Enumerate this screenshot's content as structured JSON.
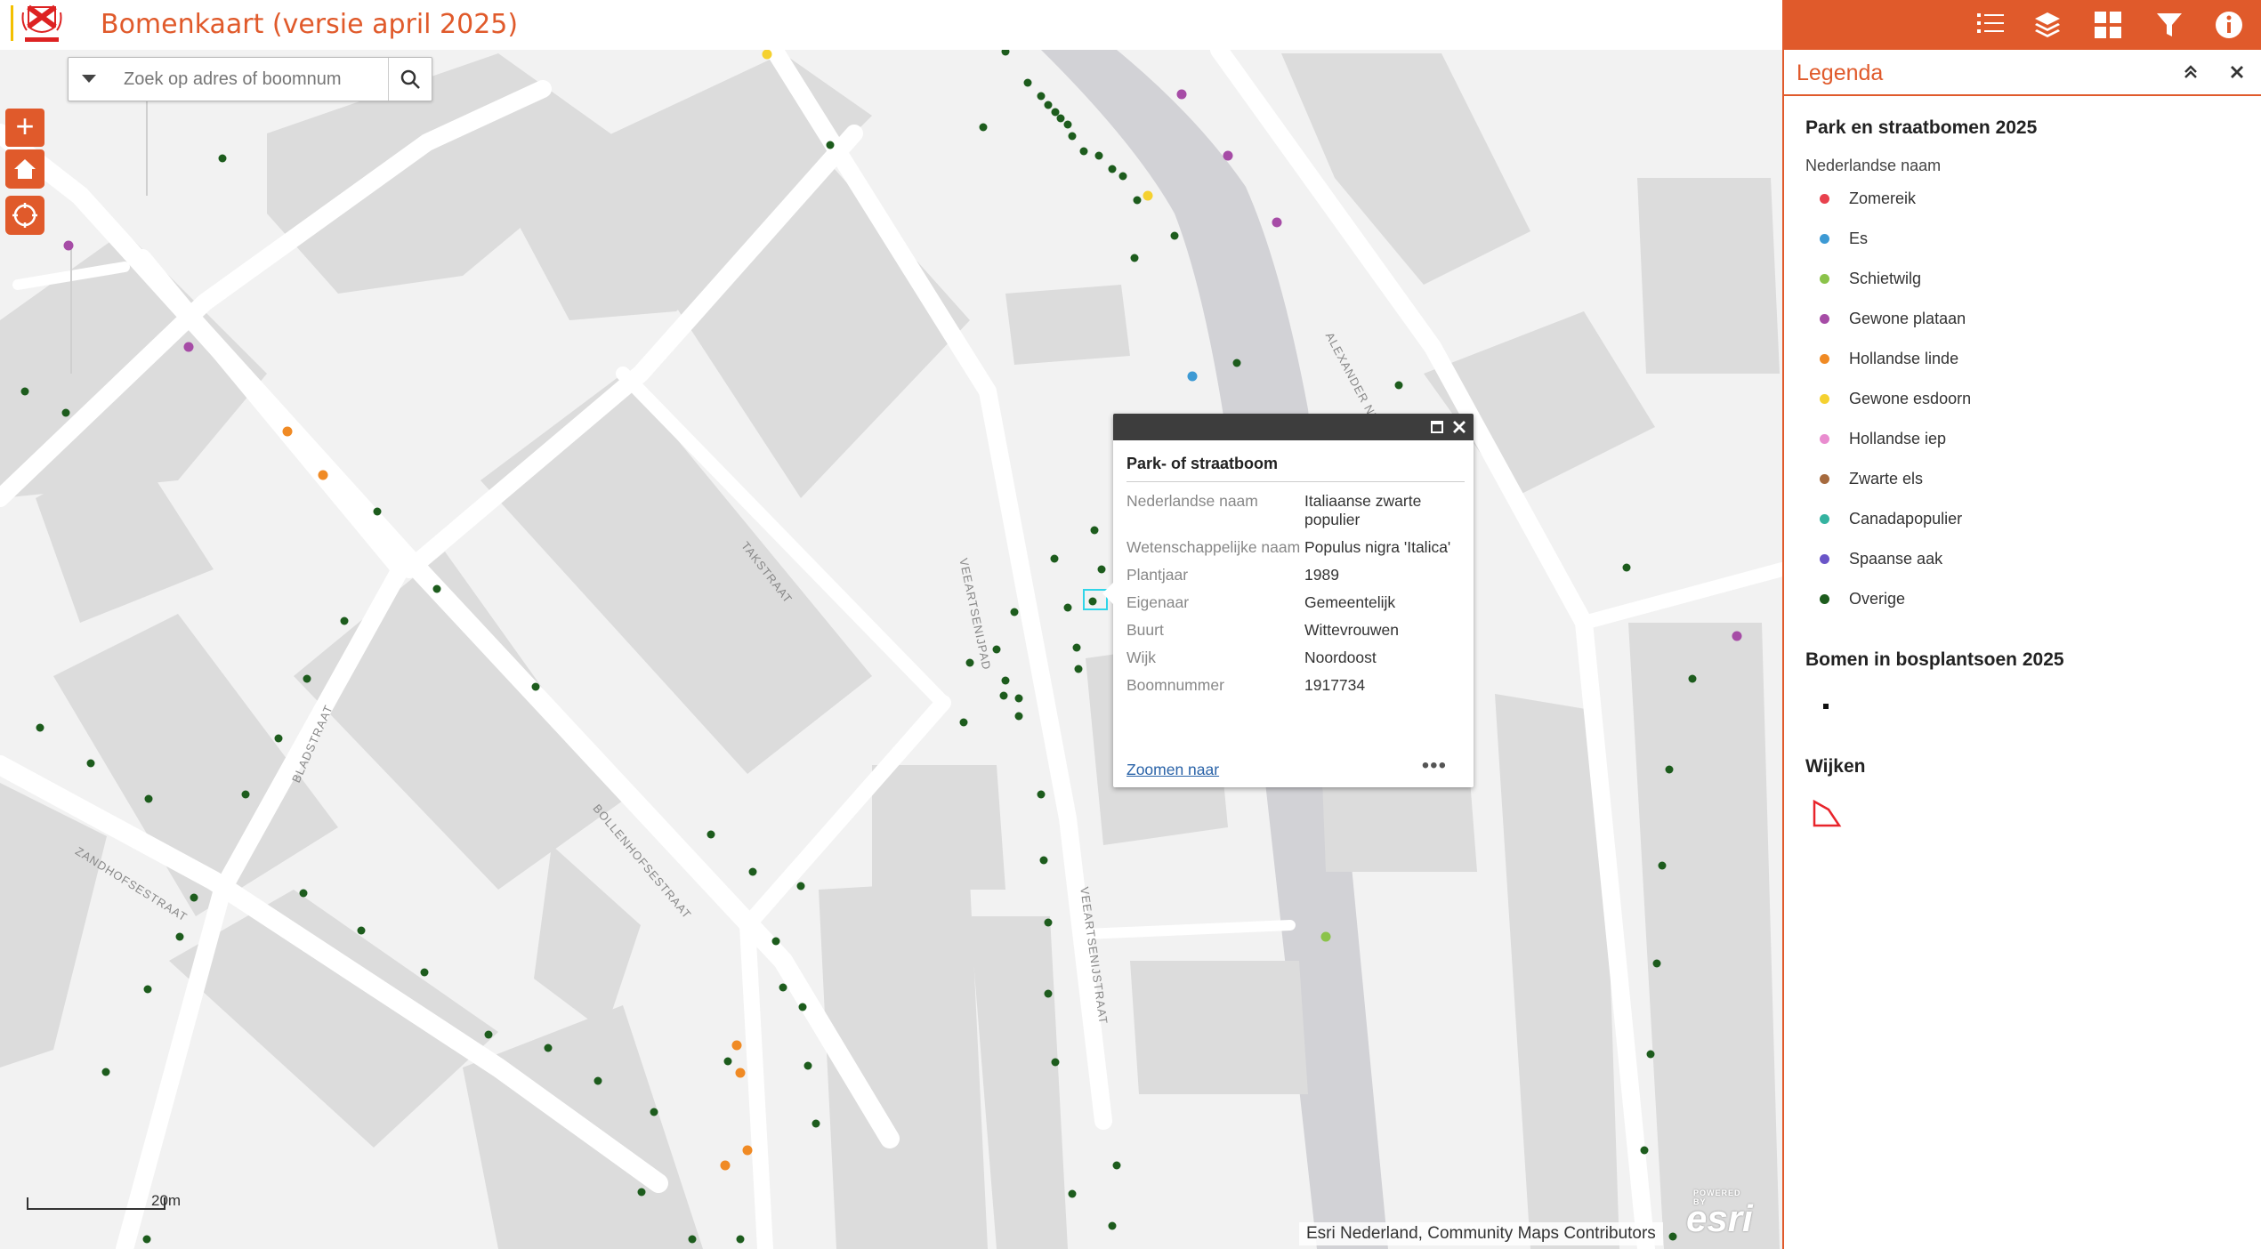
{
  "app": {
    "title": "Bomenkaart (versie april 2025)"
  },
  "toolbar": {
    "icons": [
      "list-icon",
      "layers-icon",
      "grid-icon",
      "filter-icon",
      "info-icon"
    ],
    "accent": "#e05a2b"
  },
  "search": {
    "placeholder": "Zoek op adres of boomnum"
  },
  "map": {
    "streets": [
      "TAKSTRAAT",
      "VEEARTSENIJPAD",
      "VEEARTSENIJSTRAAT",
      "BLADSTRAAT",
      "BOLLENHOFSESTRAAT",
      "ZANDHOFSESTRAAT",
      "ALEXANDER NUMANKADE"
    ],
    "scale_label": "20m",
    "attribution": "Esri Nederland, Community Maps Contributors",
    "esri_logo": "esri",
    "esri_powered": "POWERED BY"
  },
  "popup": {
    "title": "Park- of straatboom",
    "fields": [
      {
        "k": "Nederlandse naam",
        "v": "Italiaanse zwarte populier"
      },
      {
        "k": "Wetenschappelijke naam",
        "v": "Populus nigra 'Italica'"
      },
      {
        "k": "Plantjaar",
        "v": "1989"
      },
      {
        "k": "Eigenaar",
        "v": "Gemeentelijk"
      },
      {
        "k": "Buurt",
        "v": "Wittevrouwen"
      },
      {
        "k": "Wijk",
        "v": "Noordoost"
      },
      {
        "k": "Boomnummer",
        "v": "1917734"
      }
    ],
    "zoom_link": "Zoomen naar",
    "more": "•••"
  },
  "legend": {
    "title": "Legenda",
    "section1": "Park en straatbomen 2025",
    "field": "Nederlandse naam",
    "items": [
      {
        "label": "Zomereik",
        "color": "#e8414d"
      },
      {
        "label": "Es",
        "color": "#3d9ad4"
      },
      {
        "label": "Schietwilg",
        "color": "#8bc34a"
      },
      {
        "label": "Gewone plataan",
        "color": "#a64ca6"
      },
      {
        "label": "Hollandse linde",
        "color": "#f08a24"
      },
      {
        "label": "Gewone esdoorn",
        "color": "#f5d130"
      },
      {
        "label": "Hollandse iep",
        "color": "#e98ccf"
      },
      {
        "label": "Zwarte els",
        "color": "#a66a3e"
      },
      {
        "label": "Canadapopulier",
        "color": "#34b3a0"
      },
      {
        "label": "Spaanse aak",
        "color": "#6a55c8"
      },
      {
        "label": "Overige",
        "color": "#1d5c1d"
      }
    ],
    "section2": "Bomen in bosplantsoen 2025",
    "section3": "Wijken"
  }
}
